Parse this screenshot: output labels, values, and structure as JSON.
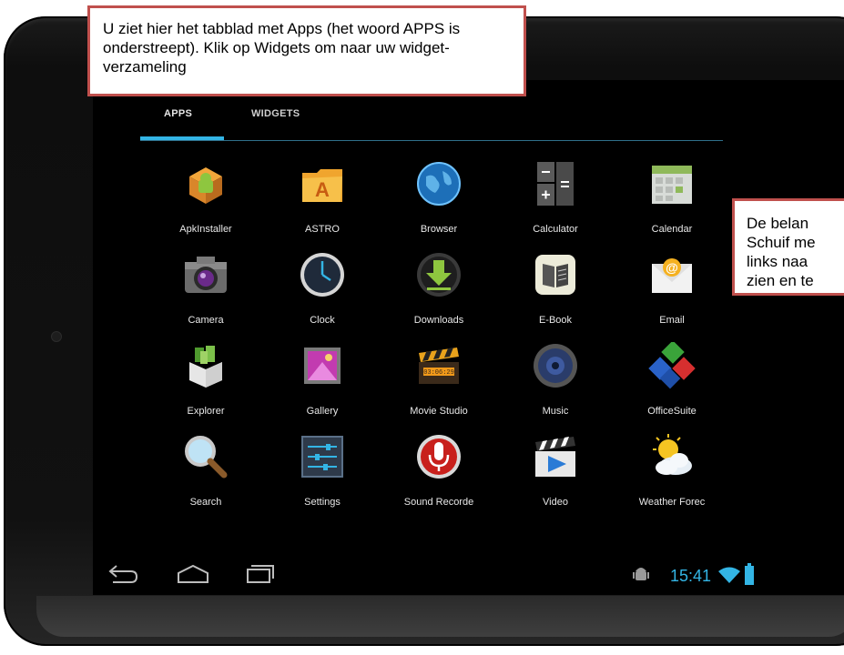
{
  "tabs": {
    "apps": "APPS",
    "widgets": "WIDGETS"
  },
  "apps": [
    {
      "label": "ApkInstaller",
      "icon": "apk-installer-icon"
    },
    {
      "label": "ASTRO",
      "icon": "astro-folder-icon"
    },
    {
      "label": "Browser",
      "icon": "globe-icon"
    },
    {
      "label": "Calculator",
      "icon": "calculator-icon"
    },
    {
      "label": "Calendar",
      "icon": "calendar-icon"
    },
    {
      "label": "Camera",
      "icon": "camera-icon"
    },
    {
      "label": "Clock",
      "icon": "clock-icon"
    },
    {
      "label": "Downloads",
      "icon": "download-icon"
    },
    {
      "label": "E-Book",
      "icon": "book-icon"
    },
    {
      "label": "Email",
      "icon": "envelope-icon"
    },
    {
      "label": "Explorer",
      "icon": "box-icon"
    },
    {
      "label": "Gallery",
      "icon": "picture-icon"
    },
    {
      "label": "Movie Studio",
      "icon": "clapperboard-icon"
    },
    {
      "label": "Music",
      "icon": "speaker-icon"
    },
    {
      "label": "OfficeSuite",
      "icon": "cubes-icon"
    },
    {
      "label": "Search",
      "icon": "magnifier-icon"
    },
    {
      "label": "Settings",
      "icon": "sliders-icon"
    },
    {
      "label": "Sound Recorde",
      "icon": "microphone-icon"
    },
    {
      "label": "Video",
      "icon": "video-icon"
    },
    {
      "label": "Weather Forec",
      "icon": "weather-sun-cloud-icon"
    }
  ],
  "status": {
    "time": "15:41"
  },
  "callouts": {
    "top": "U ziet hier het tabblad met Apps (het woord APPS is onderstreept). Klik op Widgets om naar uw widget-verzameling",
    "right": [
      "De belan",
      "Schuif me",
      "links naa",
      "zien en te"
    ]
  },
  "colors": {
    "accent": "#33b5e5",
    "callout_border": "#c0504d"
  }
}
